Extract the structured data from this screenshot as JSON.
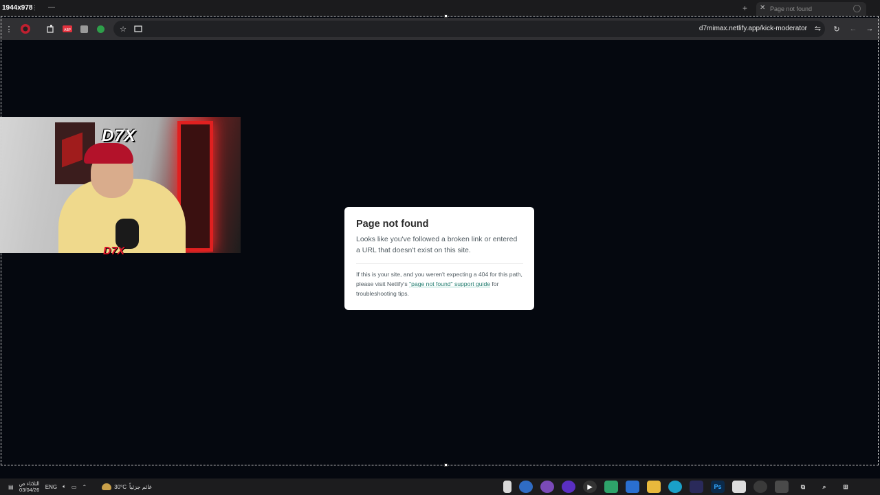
{
  "tabstrip": {
    "dimensions": "1944x978",
    "tab_title": "Page not found"
  },
  "toolbar": {
    "url": "d7mimax.netlify.app/kick-moderator"
  },
  "webcam": {
    "logo": "D7X"
  },
  "card": {
    "title": "Page not found",
    "lead": "Looks like you've followed a broken link or entered a URL that doesn't exist on this site.",
    "note_before": "If this is your site, and you weren't expecting a 404 for this path, please visit Netlify's ",
    "link_text": "\"page not found\" support guide",
    "note_after": " for troubleshooting tips."
  },
  "taskbar": {
    "time": "الثلاثاء ص",
    "date": "03/04/26",
    "language": "ENG",
    "temperature": "30°C",
    "weather_text": "غائم جزئياً"
  },
  "colors": {
    "page_bg": "#05080f",
    "card_bg": "#ffffff",
    "link": "#1d7a6c"
  }
}
